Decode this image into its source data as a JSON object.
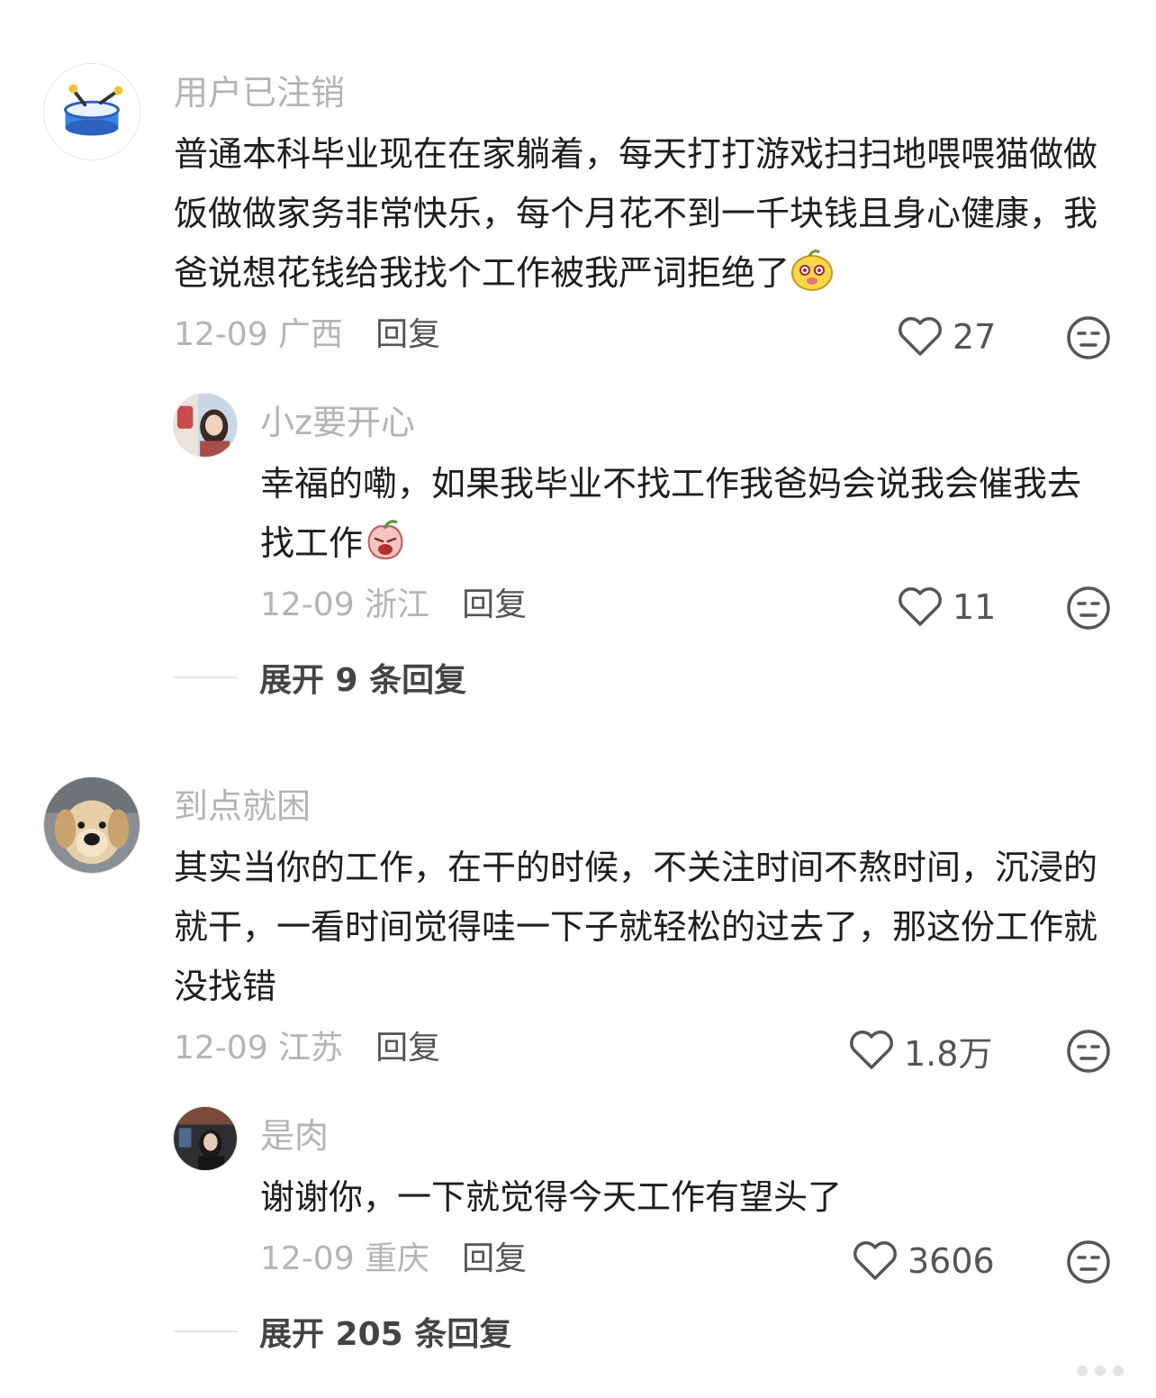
{
  "comments": [
    {
      "user": "用户已注销",
      "avatar": "drum-avatar",
      "text": "普通本科毕业现在在家躺着，每天打打游戏扫扫地喂喂猫做做饭做做家务非常快乐，每个月花不到一千块钱且身心健康，我爸说想花钱给我找个工作被我严词拒绝了",
      "emoji": "smiling-pear-emoji",
      "date": "12-09 广西",
      "reply": "回复",
      "likes": "27",
      "dislike_icon": "dislike-face-icon",
      "replies": [
        {
          "user": "小z要开心",
          "avatar": "girl-photo-avatar",
          "text": "幸福的嘞，如果我毕业不找工作我爸妈会说我会催我去找工作",
          "emoji": "crying-peach-emoji",
          "date": "12-09 浙江",
          "reply": "回复",
          "likes": "11"
        }
      ],
      "expand": "展开 9 条回复"
    },
    {
      "user": "到点就困",
      "avatar": "golden-retriever-avatar",
      "text": "其实当你的工作，在干的时候，不关注时间不熬时间，沉浸的就干，一看时间觉得哇一下子就轻松的过去了，那这份工作就没找错",
      "date": "12-09 江苏",
      "reply": "回复",
      "likes": "1.8万",
      "replies": [
        {
          "user": "是肉",
          "avatar": "person-photo-avatar",
          "text": "谢谢你，一下就觉得今天工作有望头了",
          "date": "12-09 重庆",
          "reply": "回复",
          "likes": "3606"
        }
      ],
      "expand": "展开 205 条回复"
    }
  ],
  "colors": {
    "name": "#b4b4b4",
    "text": "#1e1e1e",
    "reply": "#555555",
    "divider": "#e8e8e8"
  }
}
